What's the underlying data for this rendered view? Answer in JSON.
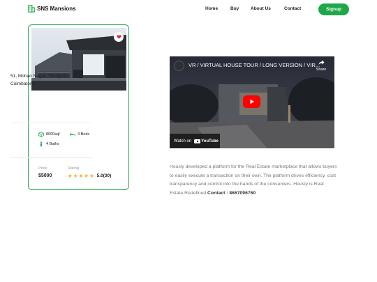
{
  "brand": {
    "name": "SNS Mansions",
    "icon": "building-icon"
  },
  "nav": {
    "links": [
      "Home",
      "Buy",
      "About Us",
      "Contact"
    ],
    "signup_label": "Signup",
    "accent_color": "#1ea84a"
  },
  "property": {
    "address": "51, Mohan Nagar, Thudiyalur, Coimbatore",
    "area": "8000sqf",
    "beds": "4 Beds",
    "baths": "4 Baths",
    "price_label": "Price",
    "price": "$5000",
    "rating_label": "Rating",
    "rating_value": "5.0(30)",
    "stars": 5,
    "favorite_icon": "heart-icon"
  },
  "video": {
    "title": "VR / VIRTUAL HOUSE TOUR / LONG VERSION / VIR...",
    "share_label": "Share",
    "watch_on": "Watch on",
    "platform": "YouTube"
  },
  "description": {
    "text": "Hously developed a platform for the Real Estate marketplace that allows buyers to easily execute a transaction on their own. The platform drives efficiency, cost transparency and control into the hands of the consumers. Hously is Real Estate Redefined.",
    "contact": "Contact : 8667096760"
  }
}
